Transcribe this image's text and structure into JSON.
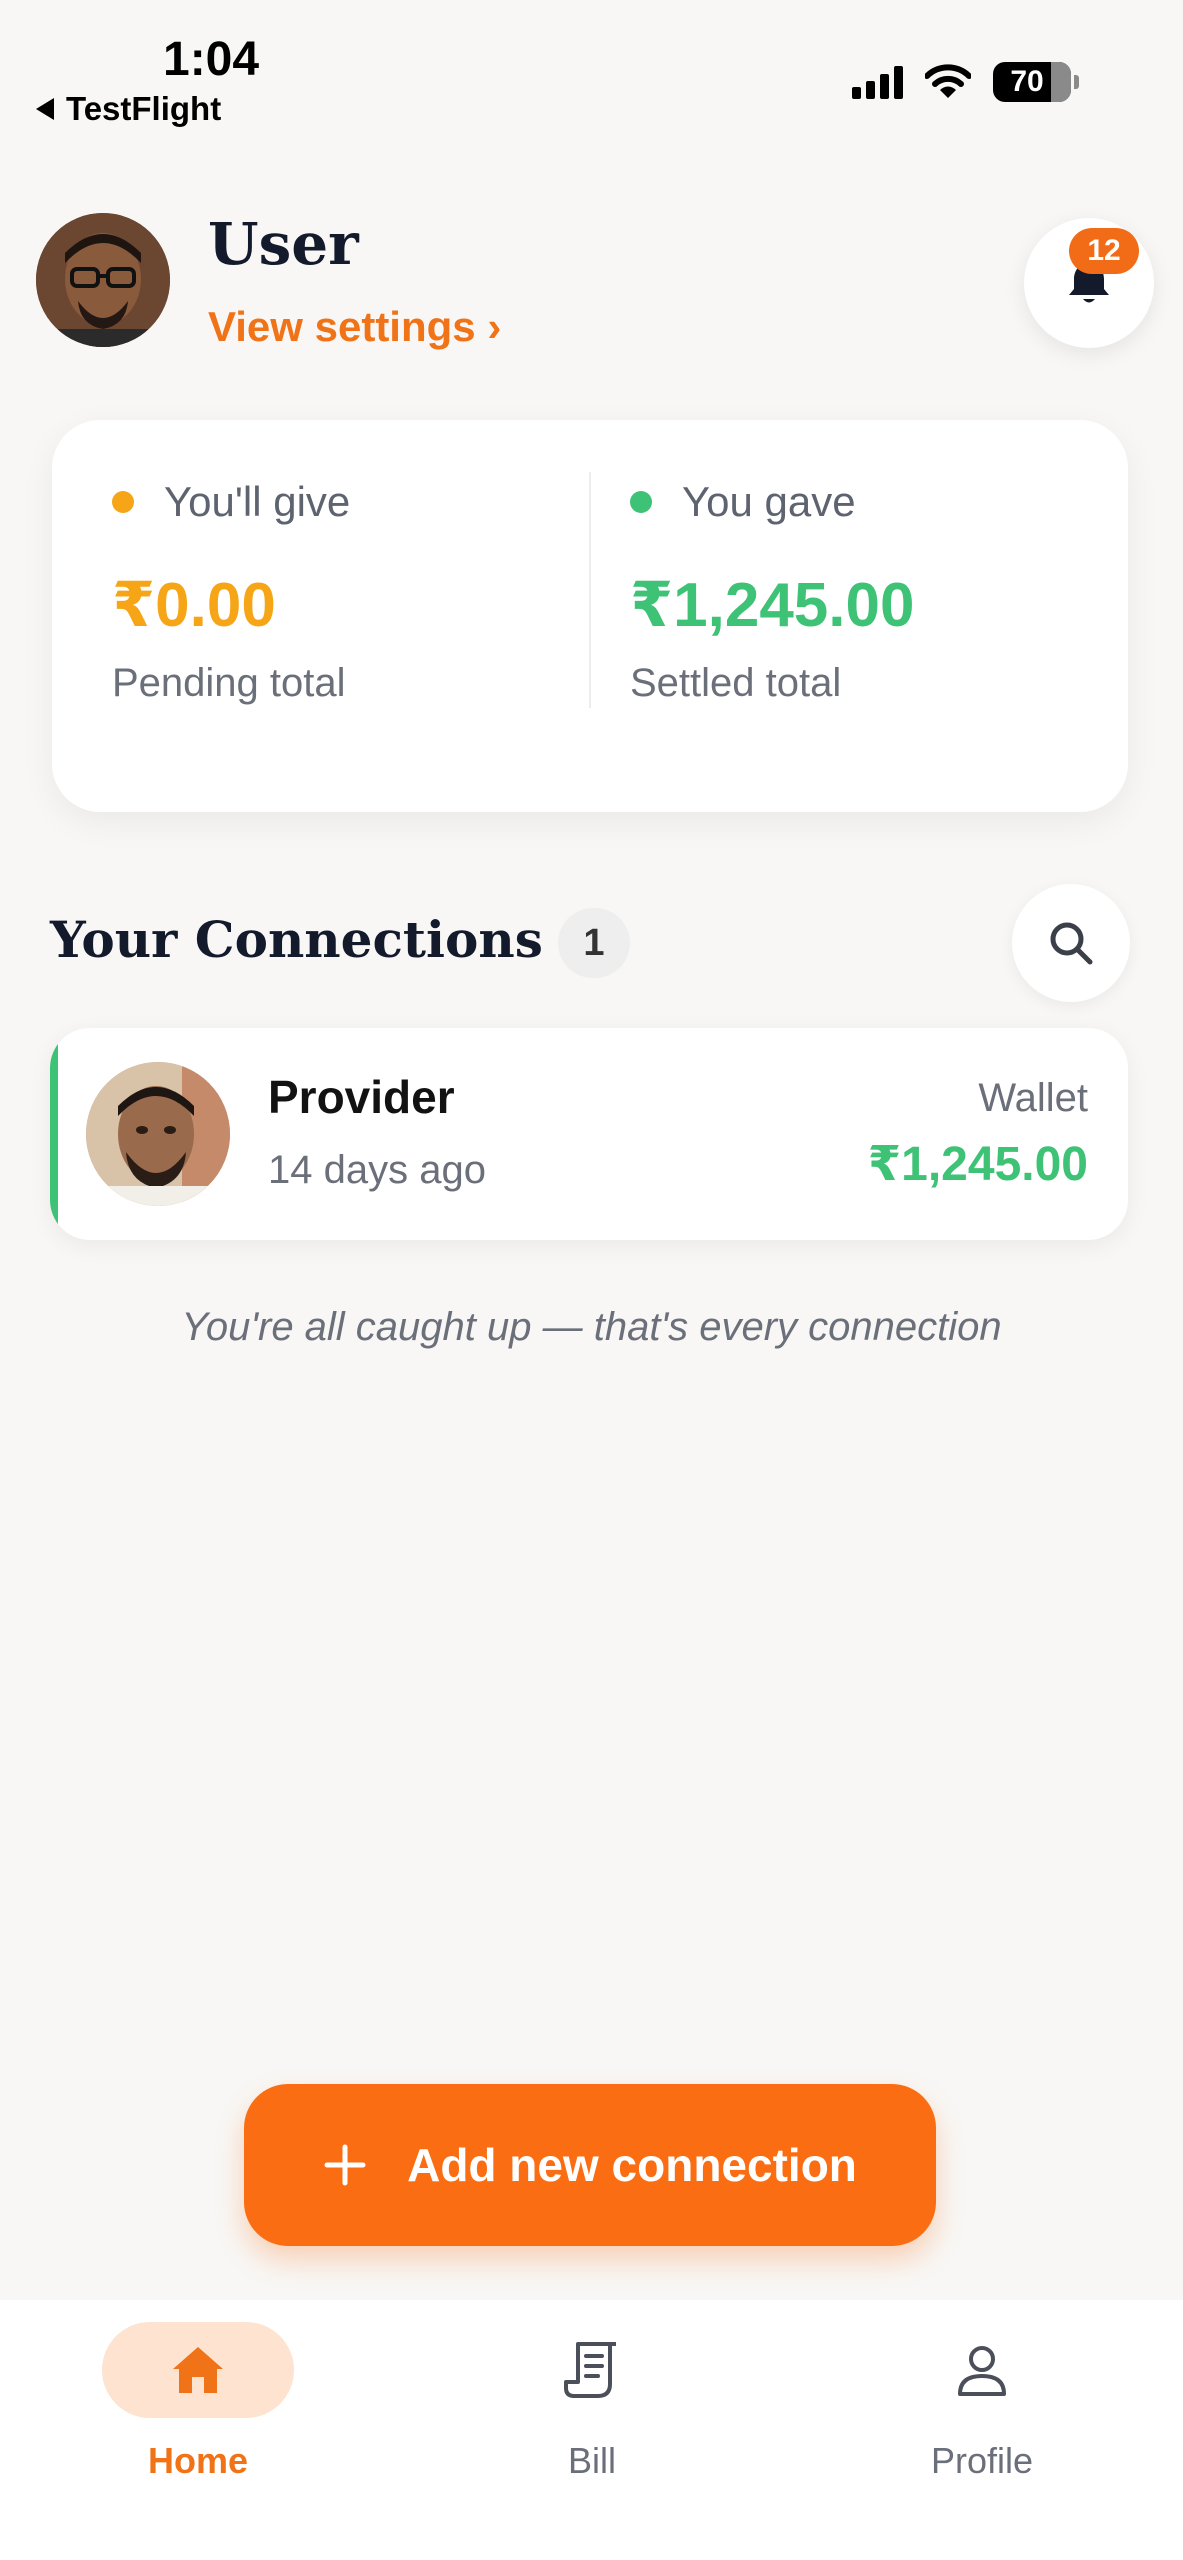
{
  "status_bar": {
    "time": "1:04",
    "back_app": "TestFlight",
    "battery": "70"
  },
  "header": {
    "user_name": "User",
    "settings_link": "View settings ›",
    "notification_count": "12"
  },
  "summary": {
    "give": {
      "label": "You'll give",
      "amount": "₹0.00",
      "sub": "Pending total",
      "color": "#f5a516"
    },
    "gave": {
      "label": "You gave",
      "amount": "₹1,245.00",
      "sub": "Settled total",
      "color": "#3ec276"
    }
  },
  "connections": {
    "title": "Your Connections",
    "count": "1",
    "items": [
      {
        "name": "Provider",
        "time": "14 days ago",
        "wallet_label": "Wallet",
        "amount": "₹1,245.00"
      }
    ],
    "footer_note": "You're all caught up — that's every connection"
  },
  "add_button": {
    "icon": "plus-icon",
    "label": "Add new connection"
  },
  "tabs": [
    {
      "label": "Home",
      "icon": "home-icon",
      "active": true
    },
    {
      "label": "Bill",
      "icon": "bill-icon",
      "active": false
    },
    {
      "label": "Profile",
      "icon": "profile-icon",
      "active": false
    }
  ],
  "colors": {
    "accent": "#f07318",
    "positive": "#3ec276",
    "pending": "#f5a516"
  }
}
